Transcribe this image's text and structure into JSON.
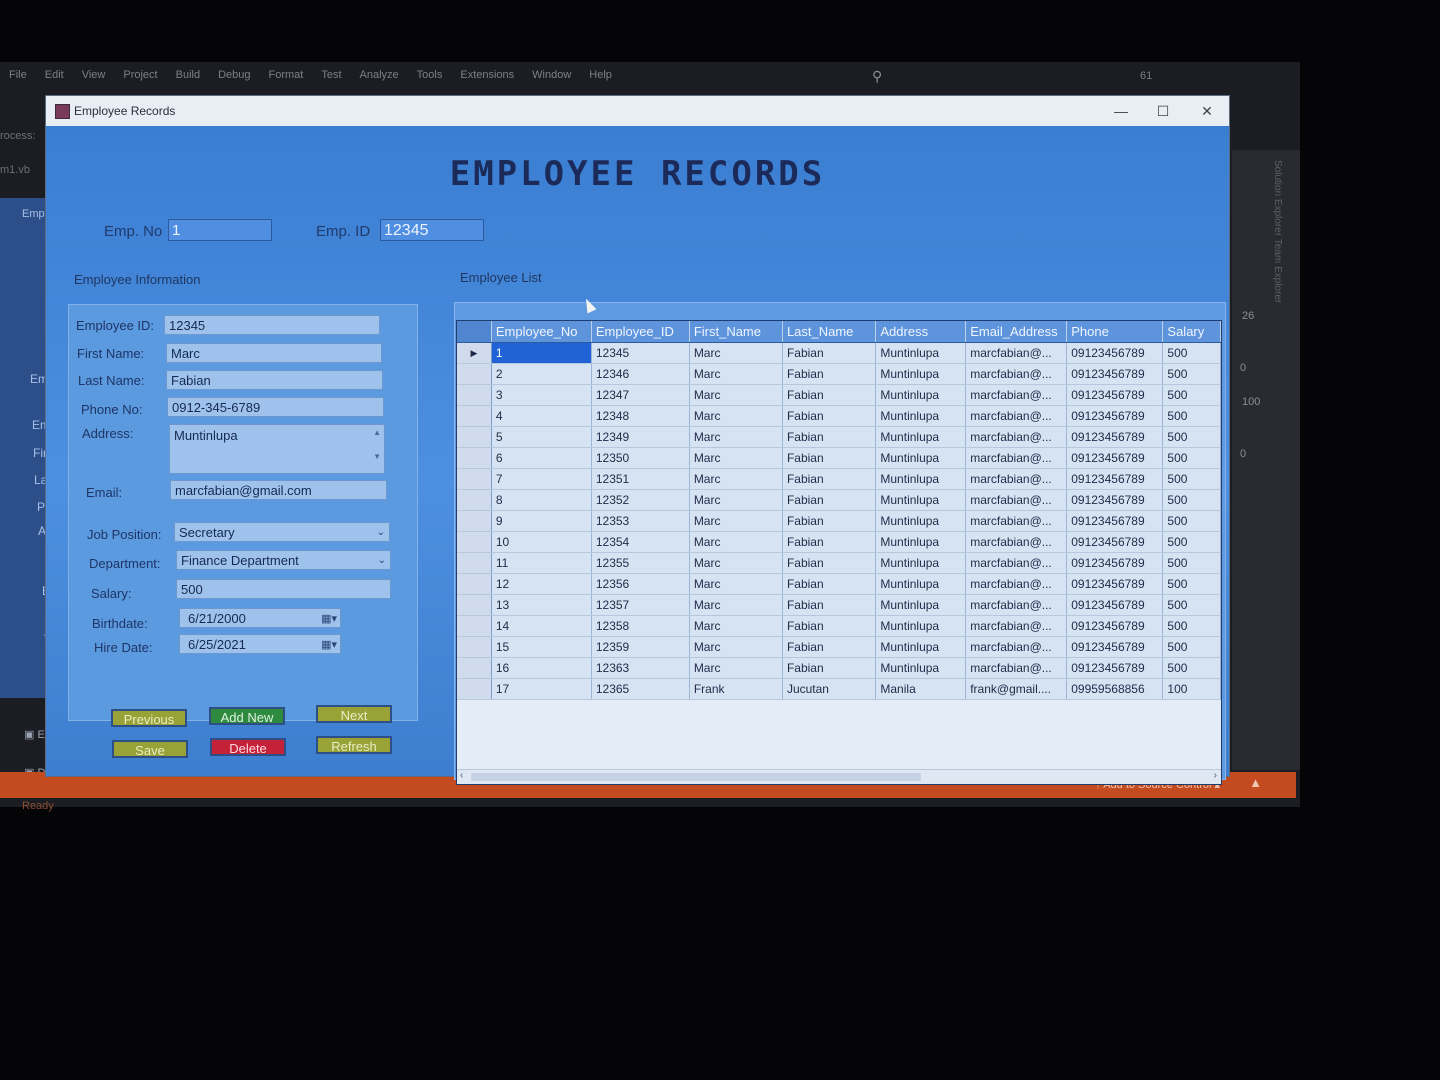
{
  "ide": {
    "menu": [
      "File",
      "Edit",
      "View",
      "Project",
      "Build",
      "Debug",
      "Format",
      "Test",
      "Analyze",
      "Tools",
      "Extensions",
      "Window",
      "Help"
    ],
    "counter": "61",
    "left_texts": [
      "rocess:",
      "m1.vb",
      "Empl"
    ],
    "right_values": [
      "26",
      "0",
      "100",
      "0"
    ],
    "right_panel_text": "Solution Explorer   Team Explorer",
    "behind_labels": [
      "Emp",
      "Emp",
      "First",
      "Last",
      "Pho",
      "Add",
      "Em",
      "Job",
      "Dep"
    ],
    "taskbar_items": [
      "Empl",
      "Depa"
    ],
    "status_ready": "Ready",
    "status_source": "Add to Source Control"
  },
  "window": {
    "title": "Employee Records",
    "headline": "EMPLOYEE RECORDS"
  },
  "top": {
    "emp_no_label": "Emp. No",
    "emp_no_value": "1",
    "emp_id_label": "Emp. ID",
    "emp_id_value": "12345"
  },
  "info": {
    "group_title": "Employee Information",
    "employee_id_label": "Employee ID:",
    "employee_id": "12345",
    "first_name_label": "First Name:",
    "first_name": "Marc",
    "last_name_label": "Last Name:",
    "last_name": "Fabian",
    "phone_label": "Phone No:",
    "phone": "0912-345-6789",
    "address_label": "Address:",
    "address": "Muntinlupa",
    "email_label": "Email:",
    "email": "marcfabian@gmail.com",
    "job_position_label": "Job Position:",
    "job_position": "Secretary",
    "department_label": "Department:",
    "department": "Finance Department",
    "salary_label": "Salary:",
    "salary": "500",
    "birthdate_label": "Birthdate:",
    "birthdate": "6/21/2000",
    "hire_date_label": "Hire Date:",
    "hire_date": "6/25/2021"
  },
  "buttons": {
    "previous": "Previous",
    "add_new": "Add New",
    "next": "Next",
    "save": "Save",
    "delete": "Delete",
    "refresh": "Refresh"
  },
  "list": {
    "group_title": "Employee List",
    "columns": [
      "Employee_No",
      "Employee_ID",
      "First_Name",
      "Last_Name",
      "Address",
      "Email_Address",
      "Phone",
      "Salary"
    ],
    "rows": [
      [
        "1",
        "12345",
        "Marc",
        "Fabian",
        "Muntinlupa",
        "marcfabian@...",
        "09123456789",
        "500"
      ],
      [
        "2",
        "12346",
        "Marc",
        "Fabian",
        "Muntinlupa",
        "marcfabian@...",
        "09123456789",
        "500"
      ],
      [
        "3",
        "12347",
        "Marc",
        "Fabian",
        "Muntinlupa",
        "marcfabian@...",
        "09123456789",
        "500"
      ],
      [
        "4",
        "12348",
        "Marc",
        "Fabian",
        "Muntinlupa",
        "marcfabian@...",
        "09123456789",
        "500"
      ],
      [
        "5",
        "12349",
        "Marc",
        "Fabian",
        "Muntinlupa",
        "marcfabian@...",
        "09123456789",
        "500"
      ],
      [
        "6",
        "12350",
        "Marc",
        "Fabian",
        "Muntinlupa",
        "marcfabian@...",
        "09123456789",
        "500"
      ],
      [
        "7",
        "12351",
        "Marc",
        "Fabian",
        "Muntinlupa",
        "marcfabian@...",
        "09123456789",
        "500"
      ],
      [
        "8",
        "12352",
        "Marc",
        "Fabian",
        "Muntinlupa",
        "marcfabian@...",
        "09123456789",
        "500"
      ],
      [
        "9",
        "12353",
        "Marc",
        "Fabian",
        "Muntinlupa",
        "marcfabian@...",
        "09123456789",
        "500"
      ],
      [
        "10",
        "12354",
        "Marc",
        "Fabian",
        "Muntinlupa",
        "marcfabian@...",
        "09123456789",
        "500"
      ],
      [
        "11",
        "12355",
        "Marc",
        "Fabian",
        "Muntinlupa",
        "marcfabian@...",
        "09123456789",
        "500"
      ],
      [
        "12",
        "12356",
        "Marc",
        "Fabian",
        "Muntinlupa",
        "marcfabian@...",
        "09123456789",
        "500"
      ],
      [
        "13",
        "12357",
        "Marc",
        "Fabian",
        "Muntinlupa",
        "marcfabian@...",
        "09123456789",
        "500"
      ],
      [
        "14",
        "12358",
        "Marc",
        "Fabian",
        "Muntinlupa",
        "marcfabian@...",
        "09123456789",
        "500"
      ],
      [
        "15",
        "12359",
        "Marc",
        "Fabian",
        "Muntinlupa",
        "marcfabian@...",
        "09123456789",
        "500"
      ],
      [
        "16",
        "12363",
        "Marc",
        "Fabian",
        "Muntinlupa",
        "marcfabian@...",
        "09123456789",
        "500"
      ],
      [
        "17",
        "12365",
        "Frank",
        "Jucutan",
        "Manila",
        "frank@gmail....",
        "09959568856",
        "100"
      ]
    ],
    "selected_row": 0
  },
  "colors": {
    "form_bg": "#3f7fcf",
    "headline": "#1c2a5a",
    "selected_cell": "#1f63d6",
    "status_bar": "#c44a20"
  }
}
